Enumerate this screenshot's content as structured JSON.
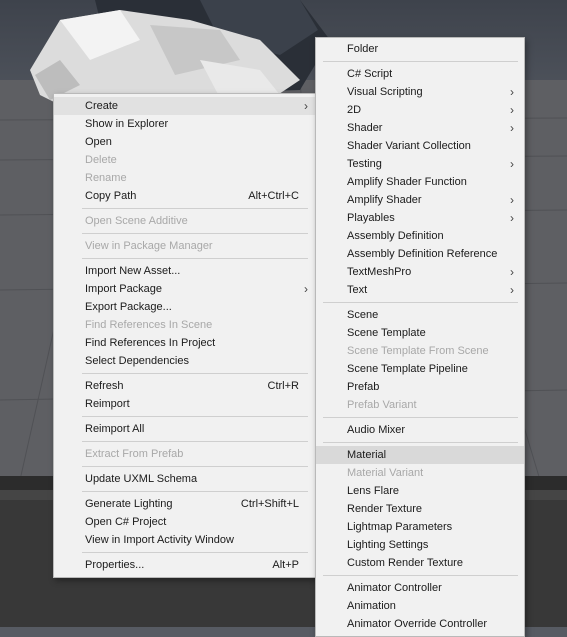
{
  "context_menu": {
    "groups": [
      [
        {
          "label": "Create",
          "submenu": true,
          "highlighted": true
        },
        {
          "label": "Show in Explorer"
        },
        {
          "label": "Open"
        },
        {
          "label": "Delete",
          "disabled": true
        },
        {
          "label": "Rename",
          "disabled": true
        },
        {
          "label": "Copy Path",
          "shortcut": "Alt+Ctrl+C"
        }
      ],
      [
        {
          "label": "Open Scene Additive",
          "disabled": true
        }
      ],
      [
        {
          "label": "View in Package Manager",
          "disabled": true
        }
      ],
      [
        {
          "label": "Import New Asset..."
        },
        {
          "label": "Import Package",
          "submenu": true
        },
        {
          "label": "Export Package..."
        },
        {
          "label": "Find References In Scene",
          "disabled": true
        },
        {
          "label": "Find References In Project"
        },
        {
          "label": "Select Dependencies"
        }
      ],
      [
        {
          "label": "Refresh",
          "shortcut": "Ctrl+R"
        },
        {
          "label": "Reimport"
        }
      ],
      [
        {
          "label": "Reimport All"
        }
      ],
      [
        {
          "label": "Extract From Prefab",
          "disabled": true
        }
      ],
      [
        {
          "label": "Update UXML Schema"
        }
      ],
      [
        {
          "label": "Generate Lighting",
          "shortcut": "Ctrl+Shift+L"
        },
        {
          "label": "Open C# Project"
        },
        {
          "label": "View in Import Activity Window"
        }
      ],
      [
        {
          "label": "Properties...",
          "shortcut": "Alt+P"
        }
      ]
    ]
  },
  "create_submenu": {
    "groups": [
      [
        {
          "label": "Folder"
        }
      ],
      [
        {
          "label": "C# Script"
        },
        {
          "label": "Visual Scripting",
          "submenu": true
        },
        {
          "label": "2D",
          "submenu": true
        },
        {
          "label": "Shader",
          "submenu": true
        },
        {
          "label": "Shader Variant Collection"
        },
        {
          "label": "Testing",
          "submenu": true
        },
        {
          "label": "Amplify Shader Function"
        },
        {
          "label": "Amplify Shader",
          "submenu": true
        },
        {
          "label": "Playables",
          "submenu": true
        },
        {
          "label": "Assembly Definition"
        },
        {
          "label": "Assembly Definition Reference"
        },
        {
          "label": "TextMeshPro",
          "submenu": true
        },
        {
          "label": "Text",
          "submenu": true
        }
      ],
      [
        {
          "label": "Scene"
        },
        {
          "label": "Scene Template"
        },
        {
          "label": "Scene Template From Scene",
          "disabled": true
        },
        {
          "label": "Scene Template Pipeline"
        },
        {
          "label": "Prefab"
        },
        {
          "label": "Prefab Variant",
          "disabled": true
        }
      ],
      [
        {
          "label": "Audio Mixer"
        }
      ],
      [
        {
          "label": "Material",
          "highlighted": true
        },
        {
          "label": "Material Variant",
          "disabled": true
        },
        {
          "label": "Lens Flare"
        },
        {
          "label": "Render Texture"
        },
        {
          "label": "Lightmap Parameters"
        },
        {
          "label": "Lighting Settings"
        },
        {
          "label": "Custom Render Texture"
        }
      ],
      [
        {
          "label": "Animator Controller"
        },
        {
          "label": "Animation"
        },
        {
          "label": "Animator Override Controller"
        }
      ]
    ]
  },
  "submenu_arrow_glyph": "›"
}
